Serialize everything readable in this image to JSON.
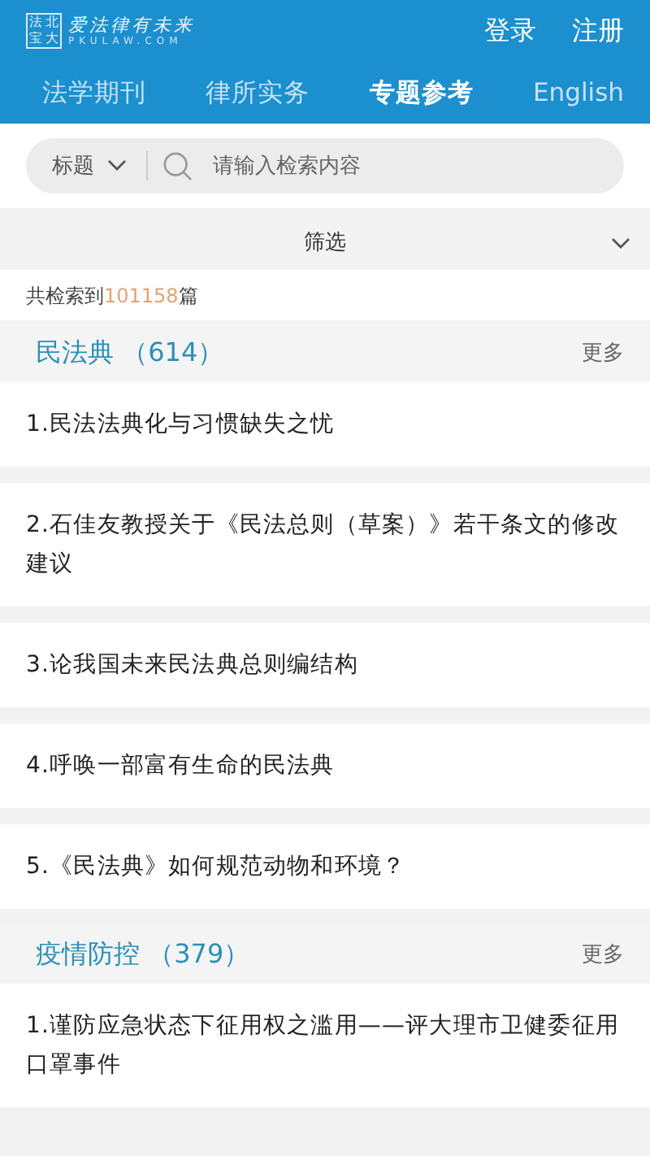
{
  "header": {
    "logo_mark": [
      "法",
      "北",
      "宝",
      "大"
    ],
    "slogan": "爱法律有未来",
    "domain": "PKULAW.COM",
    "actions": [
      "登录",
      "注册"
    ]
  },
  "tabs": [
    {
      "label": "法学期刊",
      "selected": false
    },
    {
      "label": "律所实务",
      "selected": false
    },
    {
      "label": "专题参考",
      "selected": true
    },
    {
      "label": "English",
      "selected": false
    }
  ],
  "search": {
    "scope": "标题",
    "placeholder": "请输入检索内容"
  },
  "filter": {
    "label": "筛选"
  },
  "result_count": {
    "prefix": "共检索到",
    "count": "101158",
    "suffix": "篇"
  },
  "sections": [
    {
      "title": "民法典",
      "count": "（614）",
      "more": "更多",
      "items": [
        "1.民法法典化与习惯缺失之忧",
        "2.石佳友教授关于《民法总则（草案）》若干条文的修改建议",
        "3.论我国未来民法典总则编结构",
        "4.呼唤一部富有生命的民法典",
        "5.《民法典》如何规范动物和环境？"
      ]
    },
    {
      "title": "疫情防控",
      "count": "（379）",
      "more": "更多",
      "items": [
        "1.谨防应急状态下征用权之滥用——评大理市卫健委征用口罩事件"
      ]
    }
  ]
}
